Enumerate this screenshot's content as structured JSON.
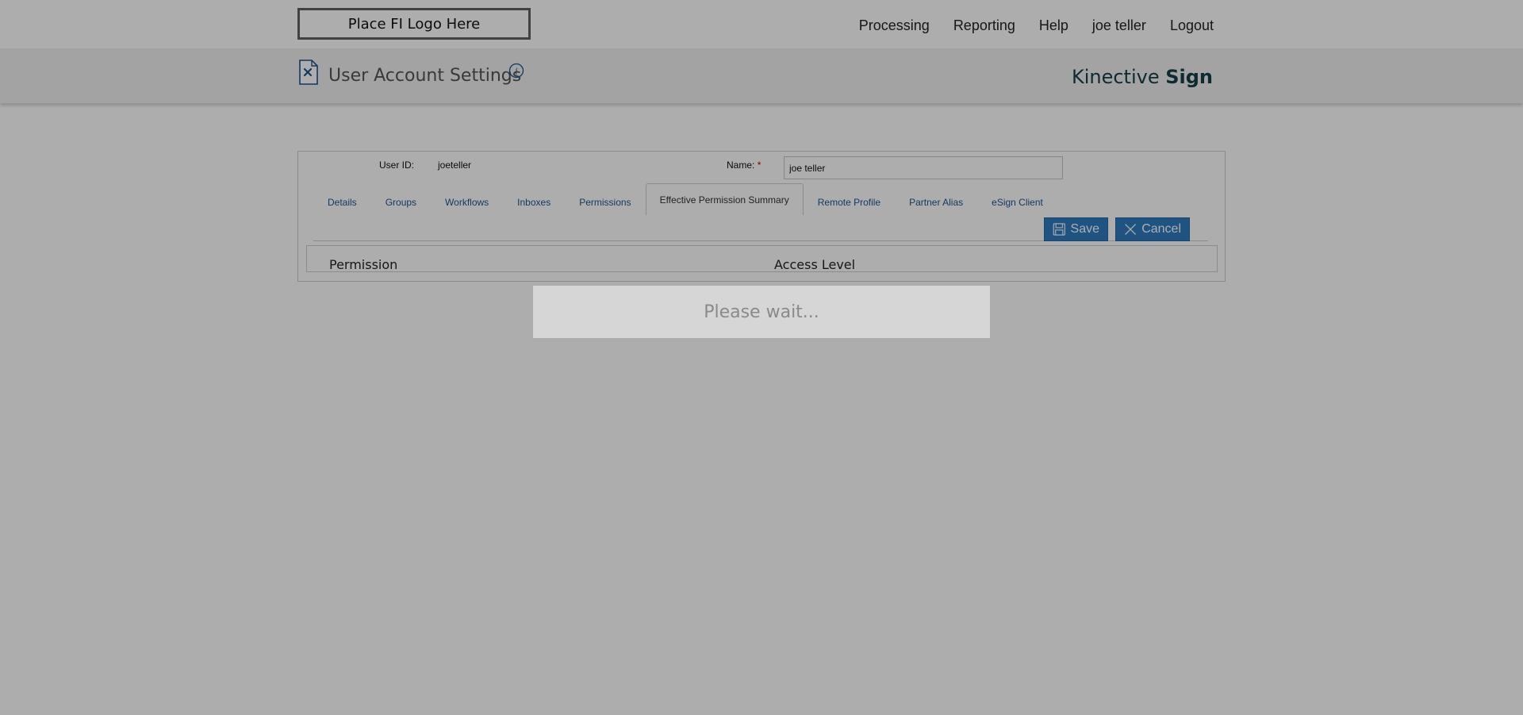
{
  "header": {
    "logo_text": "Place FI Logo Here",
    "nav": [
      "Processing",
      "Reporting",
      "Help",
      "joe teller",
      "Logout"
    ]
  },
  "titlebar": {
    "title": "User Account Settings",
    "brand_light": "Kinective",
    "brand_bold": "Sign",
    "icons": [
      "document-icon",
      "info-icon"
    ]
  },
  "form": {
    "user_id_label": "User ID:",
    "user_id_value": "joeteller",
    "name_label": "Name:",
    "required_mark": "*",
    "name_value": "joe teller"
  },
  "tabs": [
    {
      "label": "Details",
      "active": false
    },
    {
      "label": "Groups",
      "active": false
    },
    {
      "label": "Workflows",
      "active": false
    },
    {
      "label": "Inboxes",
      "active": false
    },
    {
      "label": "Permissions",
      "active": false
    },
    {
      "label": "Effective Permission Summary",
      "active": true
    },
    {
      "label": "Remote Profile",
      "active": false
    },
    {
      "label": "Partner Alias",
      "active": false
    },
    {
      "label": "eSign Client",
      "active": false
    }
  ],
  "buttons": {
    "save_label": "Save",
    "cancel_label": "Cancel"
  },
  "table": {
    "columns": [
      "Permission",
      "Access Level"
    ]
  },
  "overlay": {
    "message": "Please wait..."
  },
  "colors": {
    "accent": "#2f7dc0",
    "tab_link": "#1a5691",
    "brand": "#17404a",
    "required": "#c00000"
  }
}
